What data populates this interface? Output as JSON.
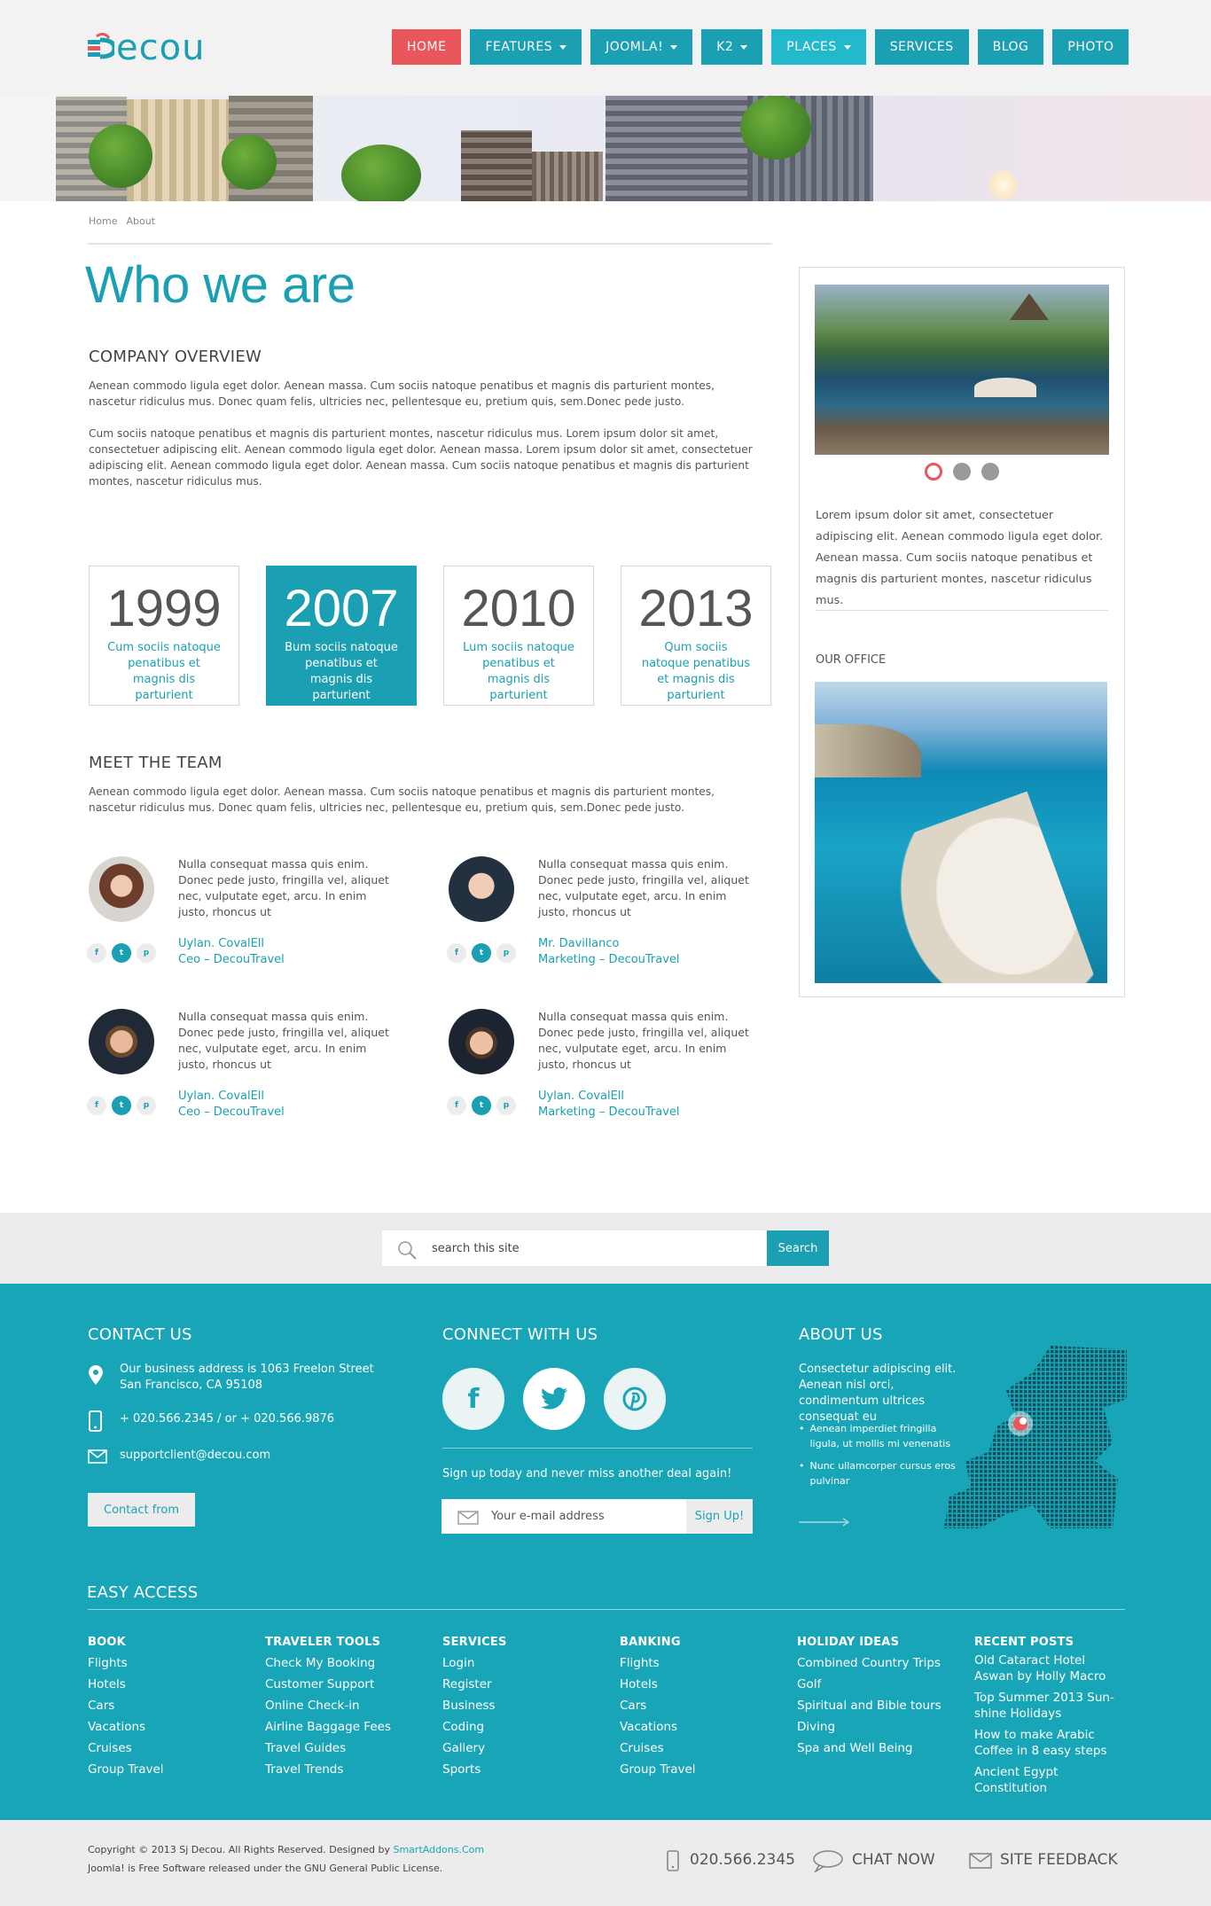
{
  "logo": {
    "text_d": "D",
    "text_rest": "ecou"
  },
  "nav": [
    {
      "label": "HOME",
      "caret": false
    },
    {
      "label": "FEATURES",
      "caret": true
    },
    {
      "label": "JOOMLA!",
      "caret": true
    },
    {
      "label": "K2",
      "caret": true
    },
    {
      "label": "PLACES",
      "caret": true
    },
    {
      "label": "SERVICES",
      "caret": false
    },
    {
      "label": "BLOG",
      "caret": false
    },
    {
      "label": "PHOTO",
      "caret": false
    }
  ],
  "breadcrumb": [
    "Home",
    "About"
  ],
  "page_title": "Who we are",
  "overview": {
    "heading": "COMPANY OVERVIEW",
    "p1": "Aenean commodo ligula eget dolor. Aenean massa. Cum sociis natoque penatibus et magnis dis parturient montes, nascetur ridiculus mus. Donec quam felis, ultricies nec, pellentesque eu, pretium quis, sem.Donec pede justo.",
    "p2": "Cum sociis natoque penatibus et magnis dis parturient montes, nascetur ridiculus mus. Lorem ipsum dolor sit amet, consectetuer adipiscing elit. Aenean commodo ligula eget dolor. Aenean massa. Lorem ipsum dolor sit amet, consectetuer adipiscing elit. Aenean commodo ligula eget dolor. Aenean massa. Cum sociis natoque penatibus et magnis dis parturient montes, nascetur ridiculus mus."
  },
  "milestones": [
    {
      "year": "1999",
      "text": "Cum sociis natoque penatibus et magnis dis parturient"
    },
    {
      "year": "2007",
      "text": "Bum sociis natoque penatibus et magnis dis parturient"
    },
    {
      "year": "2010",
      "text": "Lum sociis natoque penatibus et magnis dis parturient"
    },
    {
      "year": "2013",
      "text": "Qum sociis natoque penatibus et magnis dis parturient"
    }
  ],
  "team": {
    "heading": "MEET THE TEAM",
    "intro": "Aenean commodo ligula eget dolor. Aenean massa. Cum sociis natoque penatibus et magnis dis parturient montes, nascetur ridiculus mus. Donec quam felis, ultricies nec, pellentesque eu, pretium quis, sem.Donec pede justo.",
    "members": [
      {
        "bio": "Nulla consequat massa quis enim. Donec pede justo, fringilla vel, aliquet nec, vulputate eget, arcu. In enim justo, rhoncus ut",
        "name": "Uylan. CovalEll",
        "role": "Ceo – DecouTravel"
      },
      {
        "bio": "Nulla consequat massa quis enim. Donec pede justo, fringilla vel, aliquet nec, vulputate eget, arcu. In enim justo, rhoncus ut",
        "name": "Mr. Davillanco",
        "role": "Marketing – DecouTravel"
      },
      {
        "bio": "Nulla consequat massa quis enim. Donec pede justo, fringilla vel, aliquet nec, vulputate eget, arcu. In enim justo, rhoncus ut",
        "name": "Uylan. CovalEll",
        "role": "Ceo – DecouTravel"
      },
      {
        "bio": "Nulla consequat massa quis enim. Donec pede justo, fringilla vel, aliquet nec, vulputate eget, arcu. In enim justo, rhoncus ut",
        "name": "Uylan. CovalEll",
        "role": "Marketing – DecouTravel"
      }
    ],
    "social_icons": [
      "facebook-icon",
      "twitter-icon",
      "pinterest-icon"
    ]
  },
  "sidebar": {
    "slider_text": "Lorem ipsum dolor sit amet, consectetuer adipiscing elit. Aenean commodo ligula eget dolor. Aenean massa. Cum sociis natoque penatibus et magnis dis parturient montes, nascetur ridiculus mus.",
    "office_heading": "OUR OFFICE",
    "slider_dots": 3,
    "active_dot": 1
  },
  "search": {
    "placeholder": "search this site",
    "button": "Search"
  },
  "contact": {
    "heading": "CONTACT US",
    "address_line1": "Our business address is 1063 Freelon Street",
    "address_line2": "San Francisco, CA 95108",
    "phone": "+ 020.566.2345 / or + 020.566.9876",
    "email": "supportclient@decou.com",
    "button": "Contact from"
  },
  "connect": {
    "heading": "CONNECT WITH US",
    "signup_text": "Sign up today and never miss another deal again!",
    "email_placeholder": "Your e-mail address",
    "signup_button": "Sign Up!"
  },
  "about": {
    "heading": "ABOUT US",
    "text": "Consectetur adipiscing elit. Aenean nisl orci, condimentum ultrices consequat eu",
    "bullet1": "Aenean imperdiet fringilla ligula, ut mollis mi venenatis",
    "bullet2": "Nunc ullamcorper cursus eros pulvinar"
  },
  "easy_access": {
    "heading": "EASY ACCESS",
    "columns": [
      {
        "title": "BOOK",
        "items": [
          "Flights",
          "Hotels",
          "Cars",
          "Vacations",
          "Cruises",
          "Group Travel"
        ]
      },
      {
        "title": "TRAVELER TOOLS",
        "items": [
          "Check My Booking",
          "Customer Support",
          "Online Check-in",
          "Airline Baggage Fees",
          "Travel Guides",
          "Travel Trends"
        ]
      },
      {
        "title": "SERVICES",
        "items": [
          "Login",
          "Register",
          "Business",
          "Coding",
          "Gallery",
          "Sports"
        ]
      },
      {
        "title": "BANKING",
        "items": [
          "Flights",
          "Hotels",
          "Cars",
          "Vacations",
          "Cruises",
          "Group Travel"
        ]
      },
      {
        "title": "HOLIDAY IDEAS",
        "items": [
          "Combined Country Trips",
          "Golf",
          "Spiritual and Bible tours",
          "Diving",
          "Spa and Well Being"
        ]
      },
      {
        "title": "RECENT POSTS",
        "items": [
          "Old Cataract Hotel Aswan by Holly Macro",
          "Top Summer 2013 Sun-shine Holidays",
          "How to make Arabic Coffee in 8 easy steps",
          "Ancient Egypt Constitution"
        ]
      }
    ]
  },
  "bottom": {
    "copyright_pre": "Copyright © 2013 Sj Decou. All Rights Reserved. Designed by ",
    "copyright_link": "SmartAddons.Com",
    "license": "Joomla! is Free Software released under the GNU General Public License.",
    "phone": "020.566.2345",
    "chat": "CHAT NOW",
    "feedback": "SITE FEEDBACK"
  },
  "colors": {
    "accent": "#1a9fb3",
    "home": "#e9575d",
    "places": "#22b9cc",
    "footer": "#19a5b8"
  }
}
